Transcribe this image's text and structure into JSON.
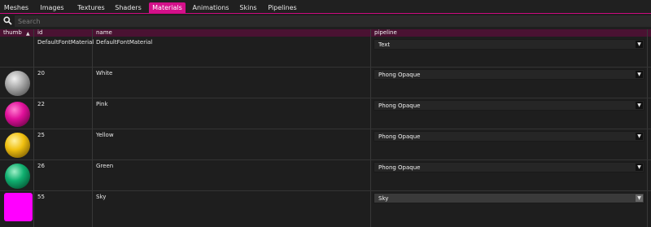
{
  "tabs": [
    {
      "label": "Meshes",
      "active": false
    },
    {
      "label": "Images",
      "active": false
    },
    {
      "label": "Textures",
      "active": false
    },
    {
      "label": "Shaders",
      "active": false
    },
    {
      "label": "Materials",
      "active": true
    },
    {
      "label": "Animations",
      "active": false
    },
    {
      "label": "Skins",
      "active": false
    },
    {
      "label": "Pipelines",
      "active": false
    }
  ],
  "search": {
    "placeholder": "Search",
    "value": "",
    "icon": "search-icon"
  },
  "table": {
    "columns": {
      "thumb": "thumb",
      "id": "id",
      "name": "name",
      "pipeline": "pipeline"
    },
    "sort": {
      "column": "thumb",
      "direction": "ascending",
      "icon": "sort-ascending-icon"
    },
    "rows": [
      {
        "thumb": {
          "kind": "none"
        },
        "id": "DefaultFontMaterial",
        "name": "DefaultFontMaterial",
        "pipeline": "Text"
      },
      {
        "thumb": {
          "kind": "sphere",
          "color": "#a0a0a0"
        },
        "id": "20",
        "name": "White",
        "pipeline": "Phong Opaque"
      },
      {
        "thumb": {
          "kind": "sphere",
          "color": "#e0109a"
        },
        "id": "22",
        "name": "Pink",
        "pipeline": "Phong Opaque"
      },
      {
        "thumb": {
          "kind": "sphere",
          "color": "#f0c010"
        },
        "id": "25",
        "name": "Yellow",
        "pipeline": "Phong Opaque"
      },
      {
        "thumb": {
          "kind": "sphere",
          "color": "#10b070"
        },
        "id": "26",
        "name": "Green",
        "pipeline": "Phong Opaque"
      },
      {
        "thumb": {
          "kind": "square",
          "color": "#ff00ff"
        },
        "id": "55",
        "name": "Sky",
        "pipeline": "Sky"
      }
    ]
  },
  "colors": {
    "accent": "#d4108a",
    "header": "#4a1232",
    "background": "#1e1e1e"
  }
}
